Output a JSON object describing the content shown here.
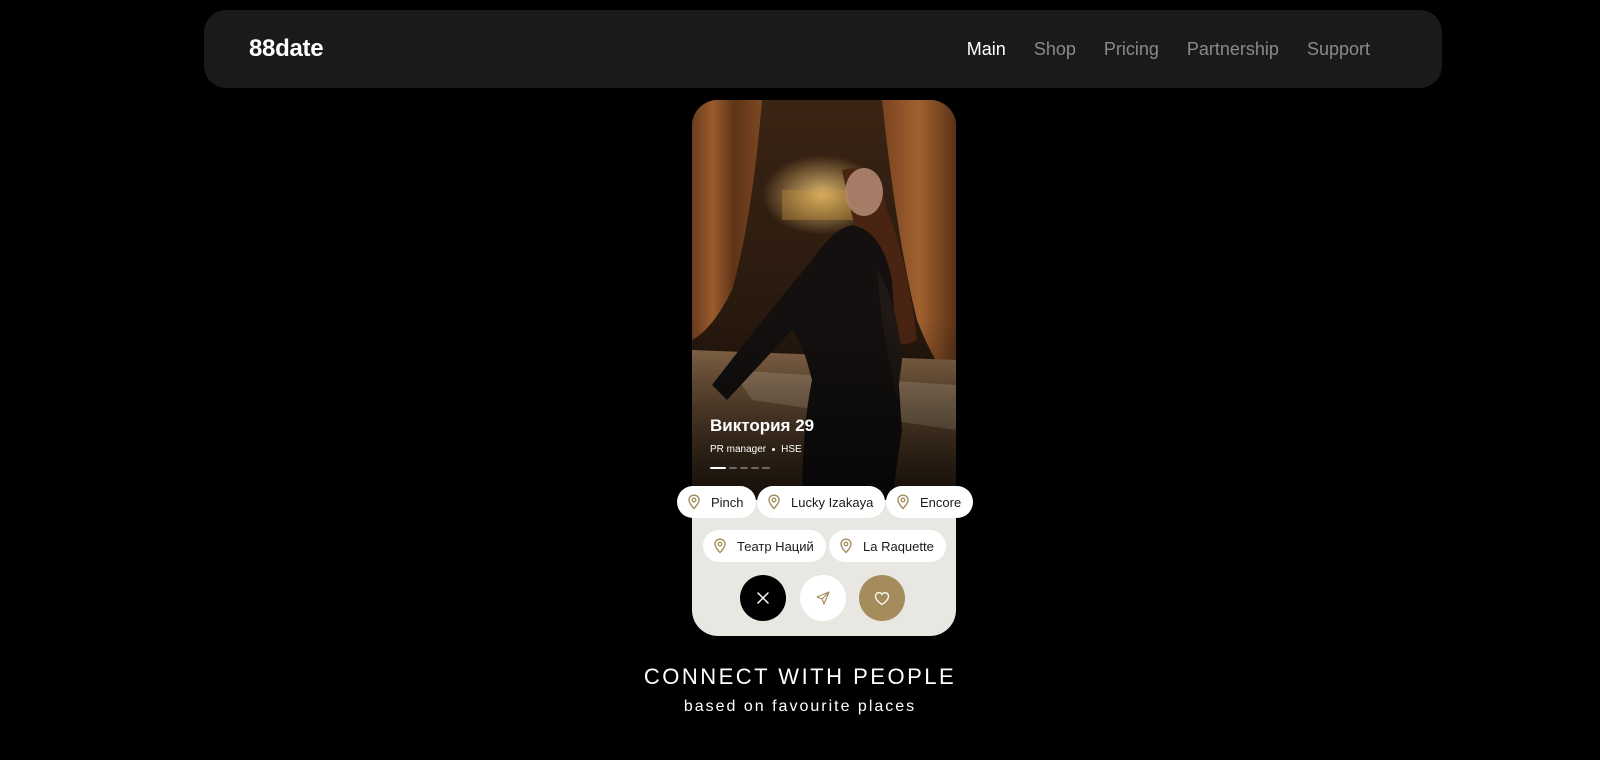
{
  "header": {
    "logo": "88date",
    "nav": [
      {
        "label": "Main",
        "active": true
      },
      {
        "label": "Shop",
        "active": false
      },
      {
        "label": "Pricing",
        "active": false
      },
      {
        "label": "Partnership",
        "active": false
      },
      {
        "label": "Support",
        "active": false
      }
    ]
  },
  "profile": {
    "name_age": "Виктория 29",
    "occupation": "PR manager",
    "education": "HSE",
    "photo_count": 5,
    "current_photo": 1
  },
  "places": [
    {
      "label": "Pinch"
    },
    {
      "label": "Lucky Izakaya"
    },
    {
      "label": "Encore"
    },
    {
      "label": "Театр Наций"
    },
    {
      "label": "La Raquette"
    }
  ],
  "actions": {
    "dislike_icon": "close-icon",
    "send_icon": "paper-plane-icon",
    "like_icon": "heart-icon"
  },
  "tagline": {
    "title": "CONNECT WITH PEOPLE",
    "subtitle": "based on favourite places"
  },
  "colors": {
    "background": "#000000",
    "header_bg": "#1a1a1a",
    "card_bg": "#e8e7e1",
    "accent_gold": "#a58c5d",
    "nav_inactive": "#8a8a8a"
  }
}
